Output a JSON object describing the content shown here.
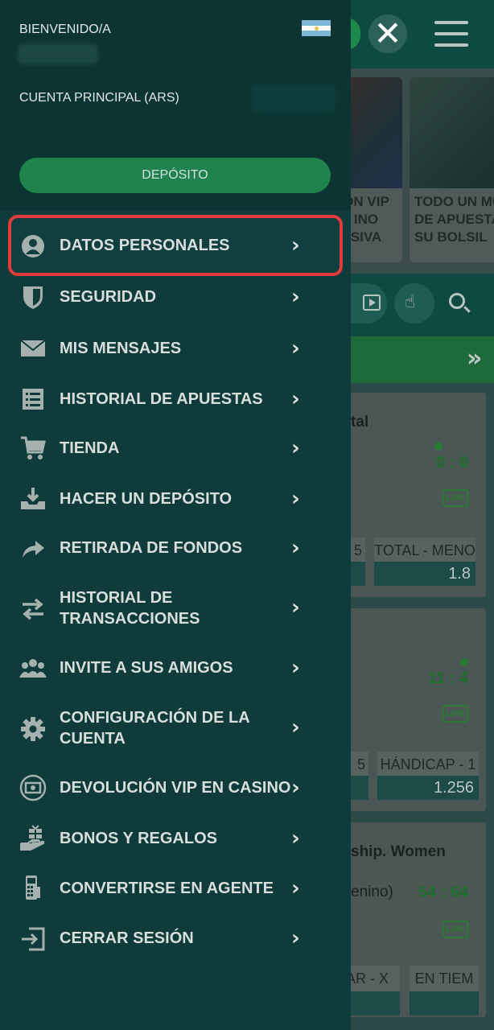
{
  "drawer": {
    "welcome": "BIENVENIDO/A",
    "account_label": "CUENTA PRINCIPAL (ARS)",
    "deposit_button": "DEPÓSITO",
    "items": [
      {
        "label": "DATOS PERSONALES",
        "icon": "user-icon"
      },
      {
        "label": "SEGURIDAD",
        "icon": "shield-icon"
      },
      {
        "label": "MIS MENSAJES",
        "icon": "envelope-icon"
      },
      {
        "label": "HISTORIAL DE APUESTAS",
        "icon": "list-icon"
      },
      {
        "label": "TIENDA",
        "icon": "cart-icon"
      },
      {
        "label": "HACER UN DEPÓSITO",
        "icon": "download-tray-icon"
      },
      {
        "label": "RETIRADA DE FONDOS",
        "icon": "share-arrow-icon"
      },
      {
        "label": "HISTORIAL DE\nTRANSACCIONES",
        "icon": "transfer-arrows-icon"
      },
      {
        "label": "INVITE A SUS AMIGOS",
        "icon": "users-group-icon"
      },
      {
        "label": "CONFIGURACIÓN DE LA\nCUENTA",
        "icon": "gear-icon"
      },
      {
        "label": "DEVOLUCIÓN VIP EN CASINO",
        "icon": "cashback-icon"
      },
      {
        "label": "BONOS Y REGALOS",
        "icon": "gift-icon"
      },
      {
        "label": "CONVERTIRSE EN AGENTE",
        "icon": "agent-terminal-icon"
      },
      {
        "label": "CERRAR SESIÓN",
        "icon": "logout-icon"
      }
    ],
    "highlighted_item": "DATOS PERSONALES"
  },
  "background": {
    "promo_cards": [
      {
        "text": "ÓN VIP\nINO\nSIVA"
      },
      {
        "text": "TODO UN MU\nDE APUESTA\nSU BOLSIL"
      }
    ],
    "matches": [
      {
        "title": "tal",
        "score_home": "0",
        "score_away": "0",
        "live": "LIVE",
        "headers": [
          "5",
          "TOTAL - MENO"
        ],
        "odds": [
          "",
          "1.8"
        ]
      },
      {
        "title": "",
        "score_home": "11",
        "score_away": "4",
        "live": "LIVE",
        "headers": [
          "5",
          "HÁNDICAP - 1"
        ],
        "odds": [
          "",
          "1.256"
        ]
      },
      {
        "title": "ship. Women",
        "subtitle": "enino)",
        "score_home": "54",
        "score_away": "64",
        "live": "LIVE",
        "headers": [
          "AR - X",
          "EN TIEM"
        ],
        "odds": [
          "",
          ""
        ]
      }
    ]
  },
  "colors": {
    "drawer_bg": "#0f3b3a",
    "accent_green": "#20834d",
    "highlight_red": "#e13b3b",
    "text": "#d7dedc"
  }
}
